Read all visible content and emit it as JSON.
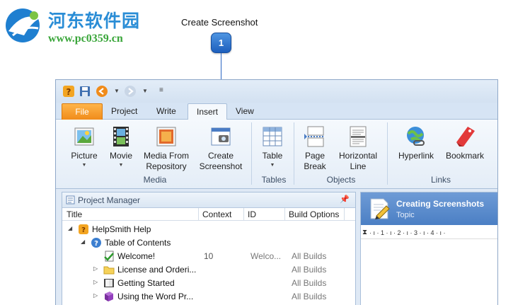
{
  "watermark": {
    "title": "河东软件园",
    "url": "www.pc0359.cn"
  },
  "callout": {
    "label": "Create Screenshot",
    "number": "1"
  },
  "tabs": [
    {
      "label": "File"
    },
    {
      "label": "Project"
    },
    {
      "label": "Write"
    },
    {
      "label": "Insert"
    },
    {
      "label": "View"
    }
  ],
  "ribbon": {
    "buttons": {
      "picture": "Picture",
      "movie": "Movie",
      "media_repo_1": "Media From",
      "media_repo_2": "Repository",
      "create_ss_1": "Create",
      "create_ss_2": "Screenshot",
      "table": "Table",
      "page_break_1": "Page",
      "page_break_2": "Break",
      "hline_1": "Horizontal",
      "hline_2": "Line",
      "hyperlink": "Hyperlink",
      "bookmark": "Bookmark"
    },
    "groups": {
      "media": "Media",
      "tables": "Tables",
      "objects": "Objects",
      "links": "Links"
    }
  },
  "project_manager": {
    "title": "Project Manager",
    "columns": {
      "title": "Title",
      "context": "Context",
      "id": "ID",
      "build": "Build Options"
    },
    "rows": [
      {
        "name": "HelpSmith Help",
        "context": "",
        "id": "",
        "build": ""
      },
      {
        "name": "Table of Contents",
        "context": "",
        "id": "",
        "build": ""
      },
      {
        "name": "Welcome!",
        "context": "10",
        "id": "Welco...",
        "build": "All Builds"
      },
      {
        "name": "License and Orderi...",
        "context": "",
        "id": "",
        "build": "All Builds"
      },
      {
        "name": "Getting Started",
        "context": "",
        "id": "",
        "build": "All Builds"
      },
      {
        "name": "Using the Word Pr...",
        "context": "",
        "id": "",
        "build": "All Builds"
      }
    ]
  },
  "editor": {
    "title": "Creating Screenshots",
    "subtitle": "Topic",
    "ruler": "·  ı  ·  1  ·  ı  ·  2  ·  ı  ·  3  ·  ı  ·  4  ·  ı  ·"
  },
  "colors": {
    "accent": "#2a66c4",
    "file_tab": "#f08b1a",
    "editor_header": "#5a8ccc"
  }
}
